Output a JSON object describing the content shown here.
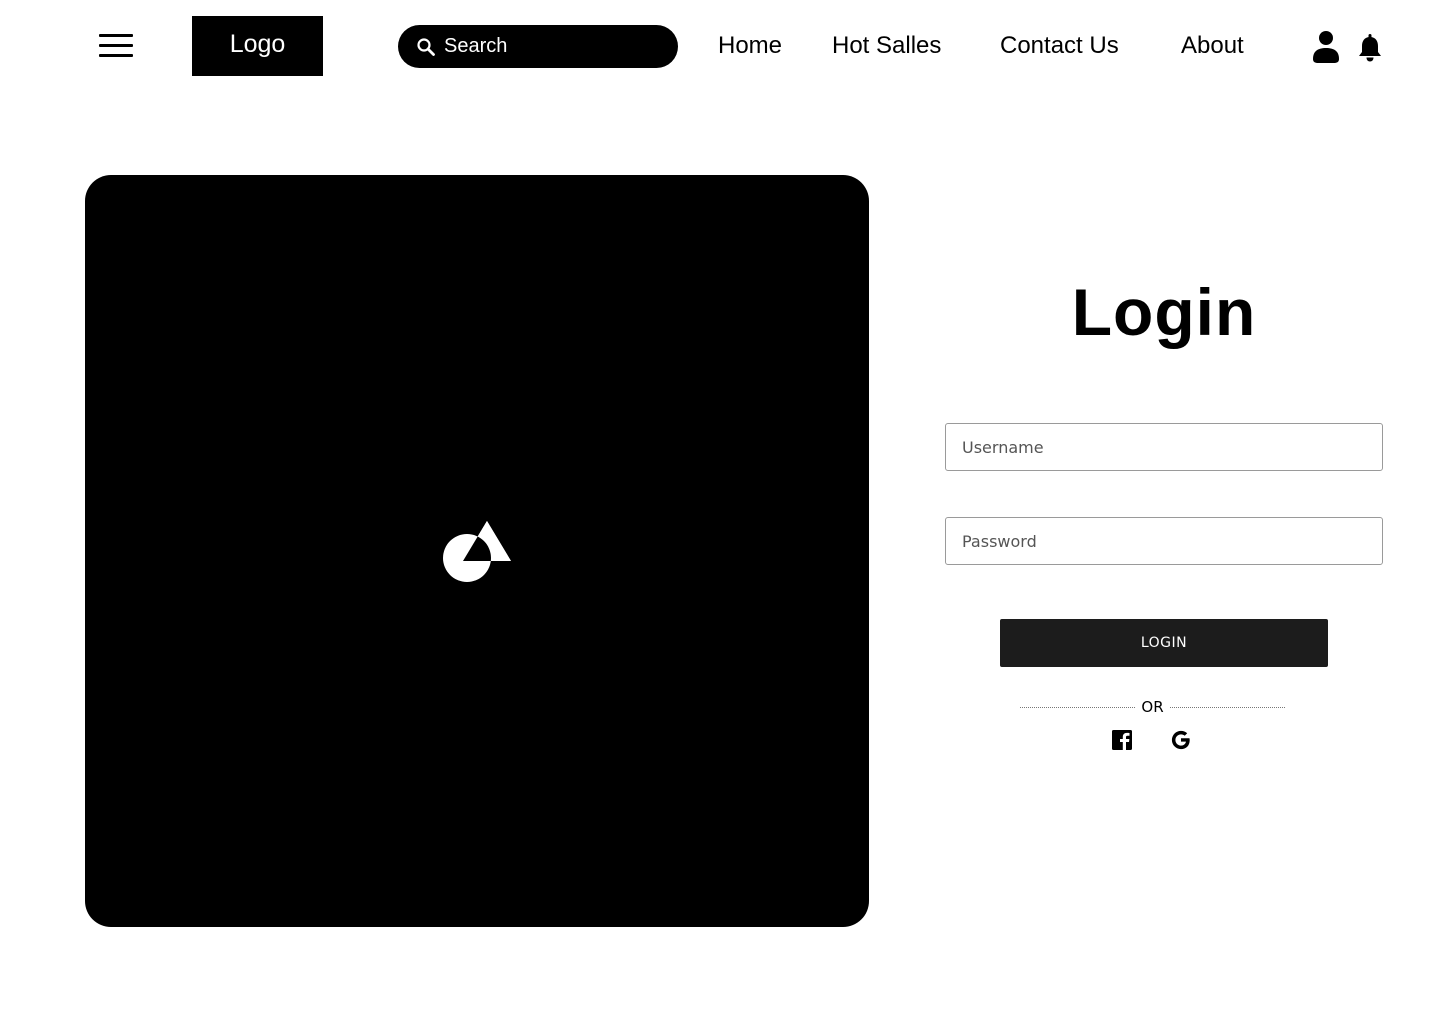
{
  "header": {
    "logo_text": "Logo",
    "search": {
      "placeholder": "Search",
      "value": ""
    },
    "nav": {
      "home": "Home",
      "hot_sales": "Hot Salles",
      "contact": "Contact Us",
      "about": "About"
    },
    "icons": [
      "menu-icon",
      "search-icon",
      "user-icon",
      "bell-icon"
    ]
  },
  "hero": {
    "placeholder_icon": "image-placeholder-icon",
    "background_color": "#000000"
  },
  "login": {
    "title": "Login",
    "username": {
      "placeholder": "Username",
      "value": ""
    },
    "password": {
      "placeholder": "Password",
      "value": ""
    },
    "submit_label": "LOGIN",
    "divider_text": "OR",
    "social": [
      "facebook-icon",
      "google-icon"
    ]
  },
  "colors": {
    "primary": "#000000",
    "button": "#1c1c1c",
    "background": "#ffffff",
    "field_border": "#9a9a9a"
  }
}
